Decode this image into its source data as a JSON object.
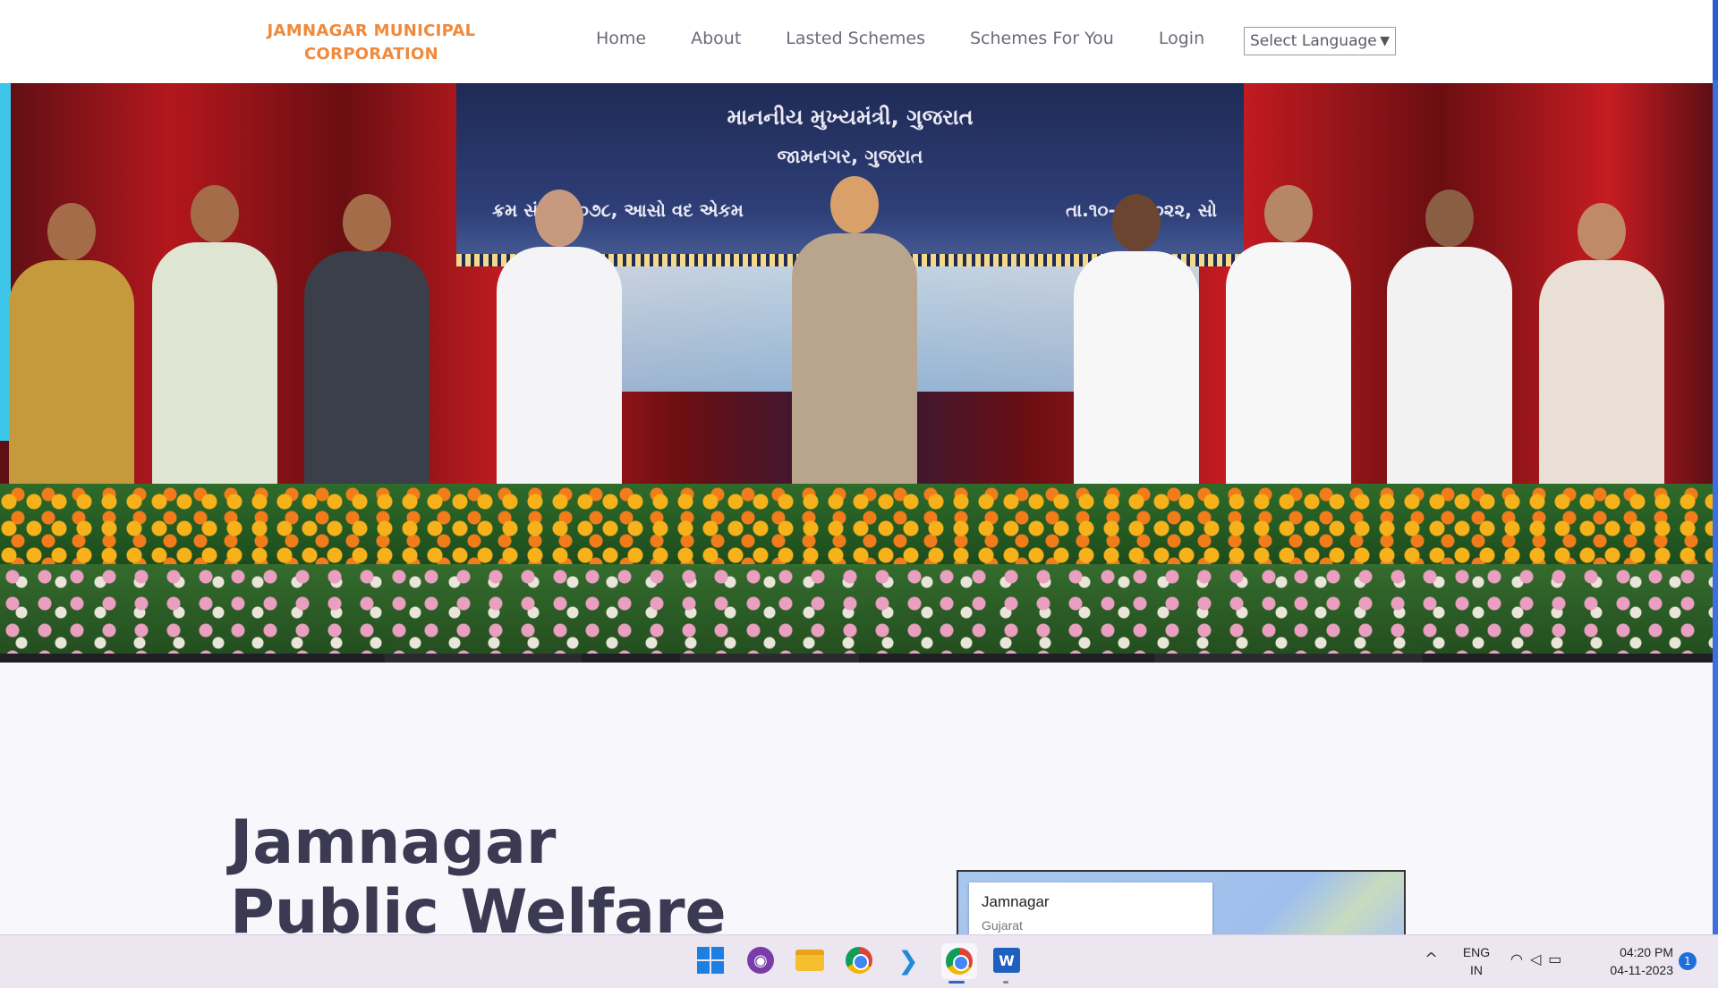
{
  "header": {
    "brand_line1": "JAMNAGAR MUNICIPAL",
    "brand_line2": "CORPORATION",
    "nav": [
      "Home",
      "About",
      "Lasted Schemes",
      "Schemes For You",
      "Login"
    ],
    "language_select": "Select Language",
    "language_arrow": "▼"
  },
  "hero": {
    "screen_line1": "માનનીય મુખ્યમંત્રી, ગુજરાત",
    "screen_line2": "જામનગર, ગુજરાત",
    "screen_line3": "ક્રમ સંવત ૨૦૭૮, આસો વદ એકમ",
    "screen_line4": "તા.૧૦-૧૦-૨૦૨૨, સો"
  },
  "content": {
    "headline_line1": "Jamnagar",
    "headline_line2": "Public Welfare",
    "map": {
      "title": "Jamnagar",
      "subtitle": "Gujarat"
    }
  },
  "taskbar": {
    "icons": [
      "windows-start-icon",
      "github-desktop-icon",
      "file-explorer-icon",
      "chrome-icon",
      "vscode-icon",
      "chrome-profile-icon",
      "word-icon"
    ],
    "tray_chevron": "^",
    "lang_line1": "ENG",
    "lang_line2": "IN",
    "time": "04:20 PM",
    "date": "04-11-2023",
    "notifications": "1"
  },
  "colors": {
    "brand": "#f0893b",
    "headline": "#3b3a52",
    "nav_text": "#6b6b7b",
    "scrollbar": "#3e6fe0"
  }
}
